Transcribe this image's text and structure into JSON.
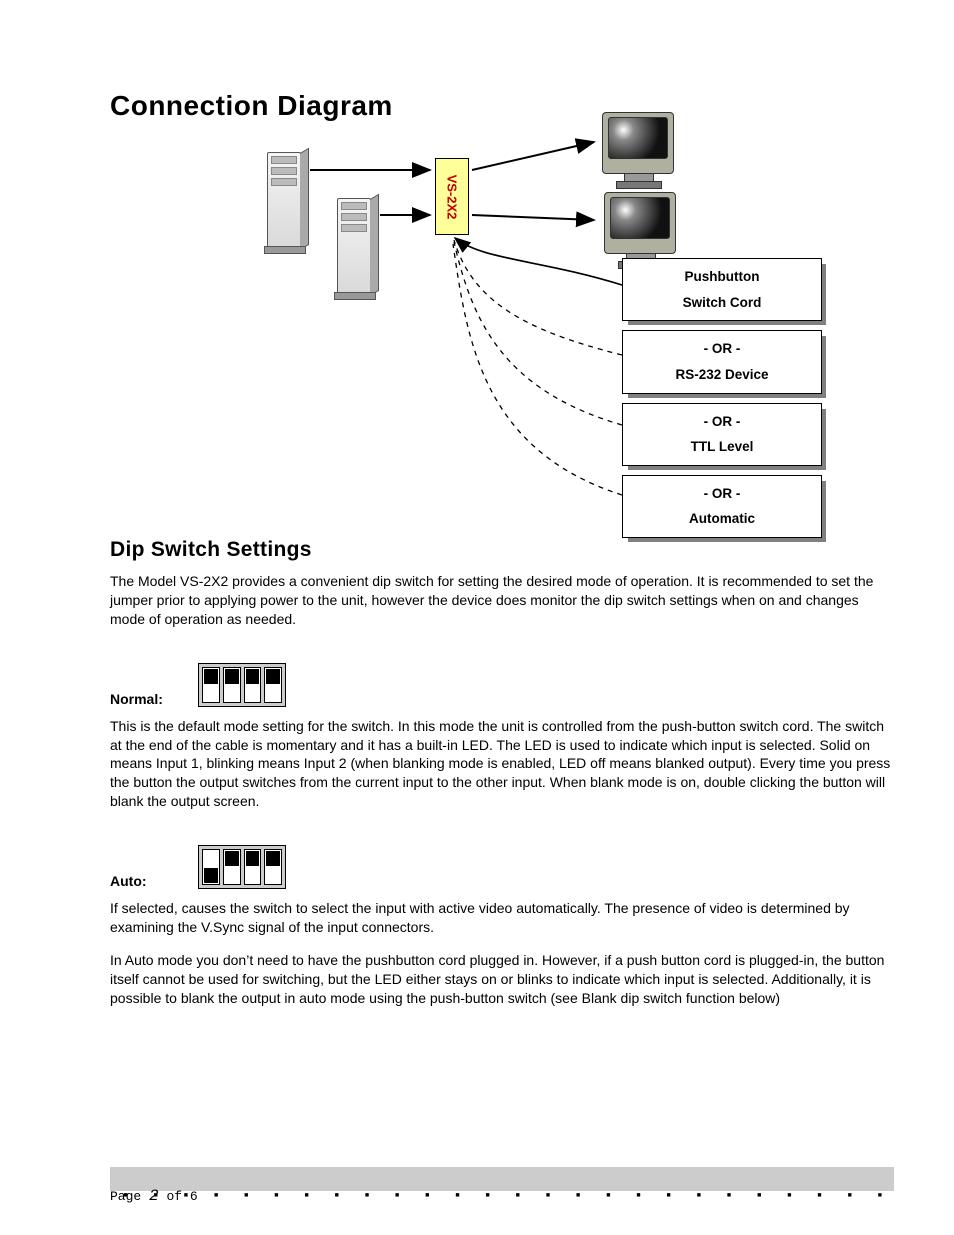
{
  "title": "Connection Diagram",
  "switch_label": "VS-2X2",
  "options": [
    {
      "lines": [
        "Pushbutton",
        "Switch Cord"
      ]
    },
    {
      "lines": [
        "- OR -",
        "RS-232 Device"
      ]
    },
    {
      "lines": [
        "- OR -",
        "TTL Level"
      ]
    },
    {
      "lines": [
        "- OR -",
        "Automatic"
      ]
    }
  ],
  "section2": {
    "heading": "Dip Switch Settings",
    "intro": "The Model VS-2X2 provides a convenient dip switch for setting the desired mode of operation. It is recommended to set the jumper prior to applying power to the unit, however the device does monitor the dip switch settings when on and changes mode of operation as needed.",
    "normal_label": "Normal:",
    "normal_positions": [
      "up",
      "up",
      "up",
      "up"
    ],
    "normal_text": "This is the default mode setting for the switch.  In this mode the unit is controlled from the push-button switch cord. The switch at the end of the cable is momentary and it has a built-in LED. The LED is used to indicate which input is selected. Solid on means Input 1, blinking means Input 2 (when blanking mode is enabled, LED  off means blanked output). Every time you press the button the output switches from the current input to the other input. When blank mode is on, double clicking the button will blank the output screen.",
    "auto_label": "Auto:",
    "auto_positions": [
      "down",
      "up",
      "up",
      "up"
    ],
    "auto_text1": "If selected, causes the switch to select the input with active video automatically. The presence of video is determined by examining the V.Sync signal of the input connectors.",
    "auto_text2": "In Auto mode you don’t need to have the pushbutton cord plugged in. However, if a push button cord is plugged-in, the button itself cannot be used for switching, but the LED either stays on or blinks to indicate which input is selected. Additionally, it is possible to blank the output in auto mode using the push-button switch (see Blank dip switch function below)"
  },
  "footer": {
    "page_word": "Page",
    "page_num": "2",
    "of_word": "of",
    "total": "6"
  }
}
